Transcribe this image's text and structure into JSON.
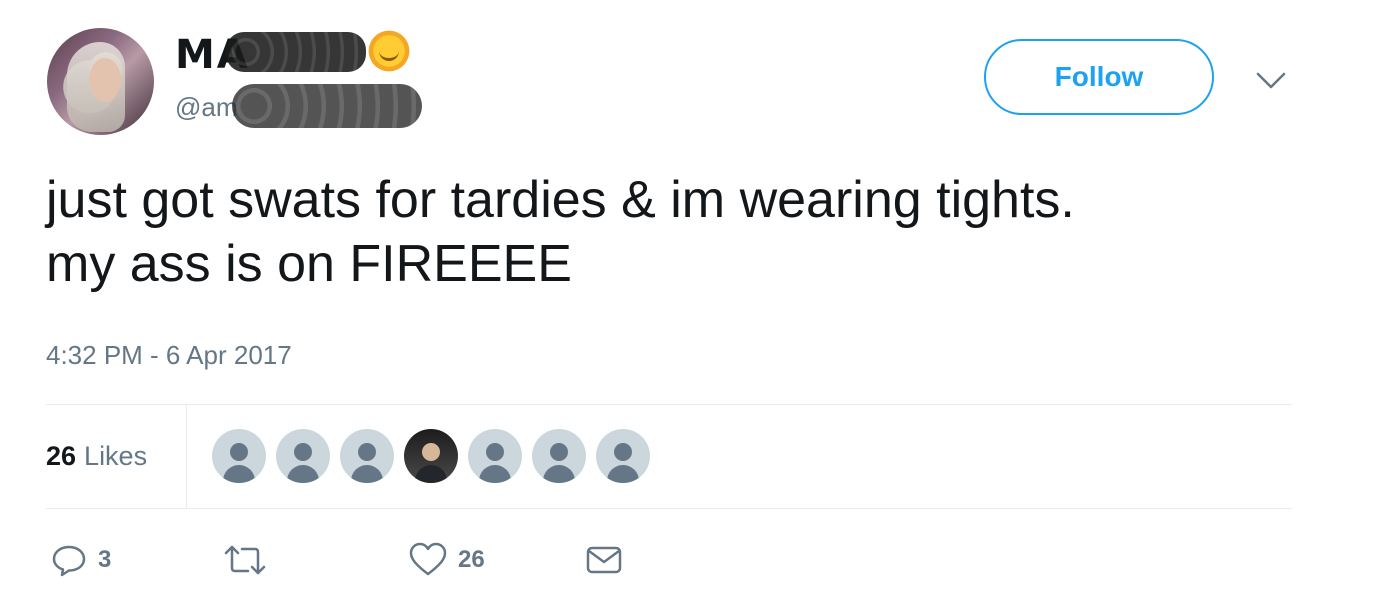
{
  "user": {
    "display_name_visible": "MA",
    "handle_visible": "@am",
    "follow_label": "Follow"
  },
  "tweet": {
    "text_line1": "just got swats for tardies & im wearing tights.",
    "text_line2": "my ass is on FIREEEE",
    "timestamp": "4:32 PM - 6 Apr 2017"
  },
  "stats": {
    "likes_count": "26",
    "likes_label": "Likes",
    "liker_avatars": [
      "default",
      "default",
      "default",
      "photo",
      "default",
      "default",
      "default"
    ]
  },
  "actions": {
    "reply_count": "3",
    "retweet_count": "",
    "like_count": "26"
  },
  "colors": {
    "accent": "#1da1f2",
    "secondary_text": "#657786",
    "primary_text": "#14171a",
    "divider": "#e6ecf0"
  },
  "icons": [
    "caret-down-icon",
    "reply-icon",
    "retweet-icon",
    "heart-icon",
    "message-icon"
  ]
}
